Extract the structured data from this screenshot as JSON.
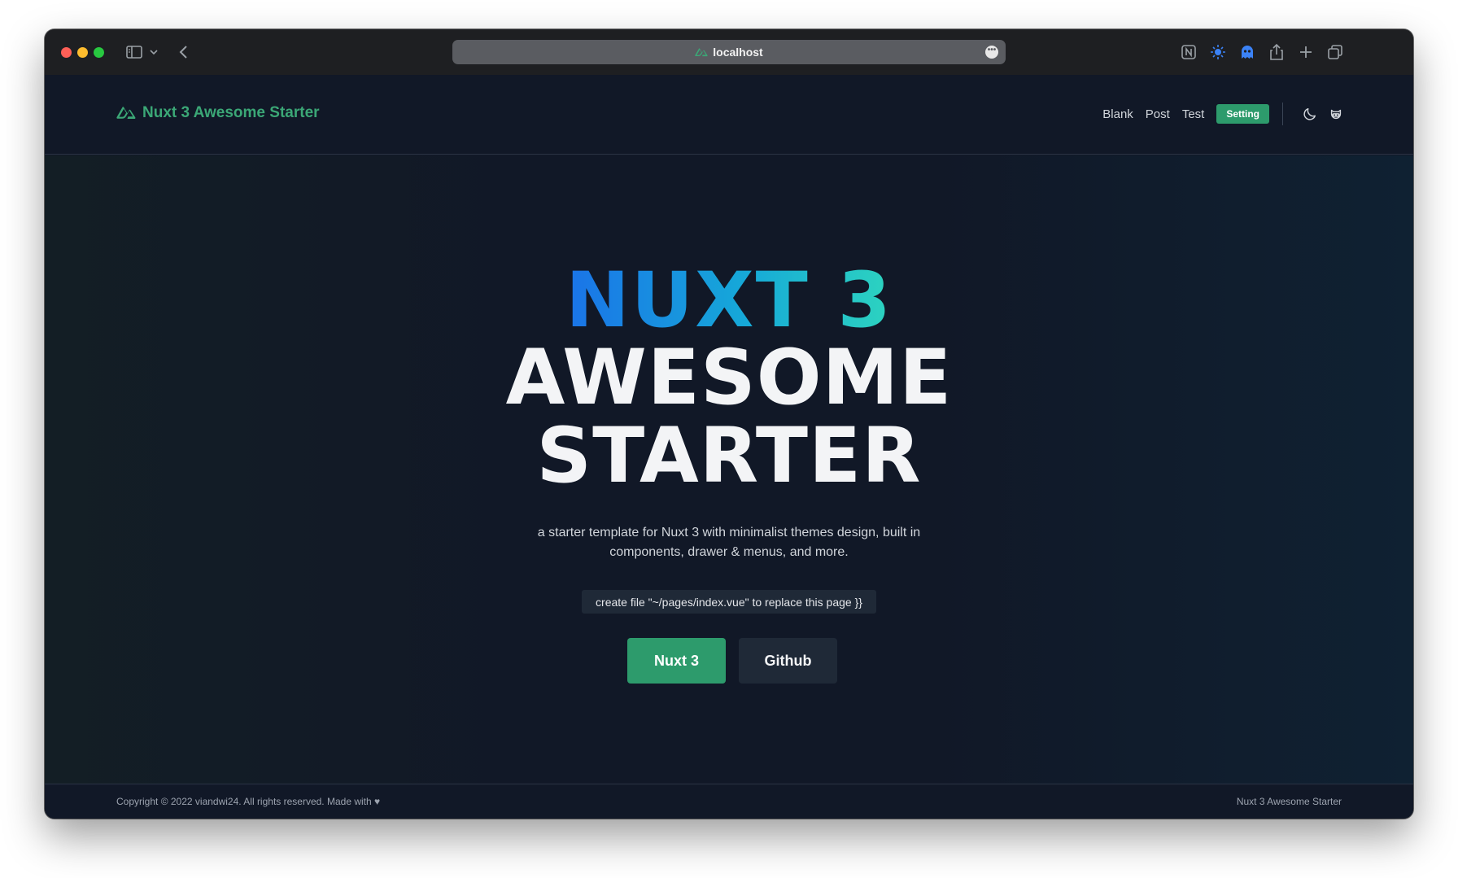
{
  "browser": {
    "address": "localhost",
    "more_glyph": "•••"
  },
  "header": {
    "brand": "Nuxt 3 Awesome Starter",
    "nav": [
      {
        "label": "Blank"
      },
      {
        "label": "Post"
      },
      {
        "label": "Test"
      }
    ],
    "setting_label": "Setting"
  },
  "hero": {
    "line1": "NUXT 3",
    "line2": "AWESOME",
    "line3": "STARTER",
    "subtitle": "a starter template for Nuxt 3 with minimalist themes design, built in components, drawer & menus, and more.",
    "code_hint": "create file \"~/pages/index.vue\" to replace this page }}",
    "primary_button": "Nuxt 3",
    "secondary_button": "Github"
  },
  "footer": {
    "copyright": "Copyright © 2022 viandwi24. All rights reserved. Made with ♥",
    "right_text": "Nuxt 3 Awesome Starter"
  },
  "colors": {
    "accent": "#2d9b6c",
    "background": "#111827",
    "gradient_start": "#1a73e8",
    "gradient_end": "#2dd4bf"
  }
}
